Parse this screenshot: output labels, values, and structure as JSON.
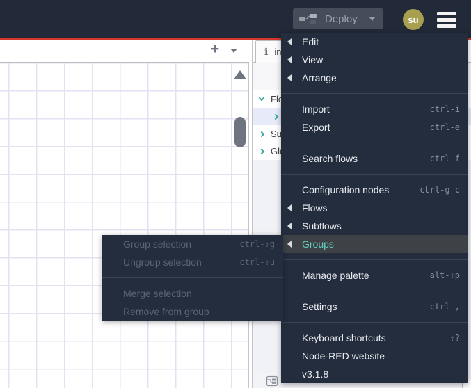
{
  "header": {
    "deploy_button": {
      "label": "Deploy",
      "icon": "deploy-node-icon",
      "state": "disabled"
    },
    "user_avatar": {
      "initials": "su"
    },
    "menu_button": {
      "icon": "hamburger"
    }
  },
  "workspace": {
    "tabbar": {
      "add_glyph": "+",
      "tab_list_icon": "chevron-down"
    },
    "canvas": {
      "grid_size_px": 40,
      "scroll_up_icon": "triangle-up"
    }
  },
  "sidebar": {
    "active_tab": {
      "label": "info",
      "icon_glyph": "i"
    },
    "tree": {
      "rows": [
        {
          "label": "Flows",
          "state": "expanded",
          "level": 0,
          "selected": false
        },
        {
          "label": "",
          "state": "collapsed",
          "level": 1,
          "selected": true
        },
        {
          "label": "Subflows",
          "state": "collapsed",
          "level": 0,
          "selected": false
        },
        {
          "label": "Global Configuration Nodes",
          "state": "collapsed",
          "level": 0,
          "selected": false
        }
      ]
    }
  },
  "menu": {
    "items": [
      {
        "label": "Edit",
        "shortcut": "",
        "has_submenu": true
      },
      {
        "label": "View",
        "shortcut": "",
        "has_submenu": true
      },
      {
        "label": "Arrange",
        "shortcut": "",
        "has_submenu": true
      },
      {
        "label": "Import",
        "shortcut": "ctrl-i",
        "has_submenu": false
      },
      {
        "label": "Export",
        "shortcut": "ctrl-e",
        "has_submenu": false
      },
      {
        "label": "Search flows",
        "shortcut": "ctrl-f",
        "has_submenu": false
      },
      {
        "label": "Configuration nodes",
        "shortcut": "ctrl-g c",
        "has_submenu": false
      },
      {
        "label": "Flows",
        "shortcut": "",
        "has_submenu": true
      },
      {
        "label": "Subflows",
        "shortcut": "",
        "has_submenu": true
      },
      {
        "label": "Groups",
        "shortcut": "",
        "has_submenu": true,
        "active": true
      },
      {
        "label": "Manage palette",
        "shortcut": "alt-⇧p",
        "has_submenu": false
      },
      {
        "label": "Settings",
        "shortcut": "ctrl-,",
        "has_submenu": false
      },
      {
        "label": "Keyboard shortcuts",
        "shortcut": "⇧?",
        "has_submenu": false
      },
      {
        "label": "Node-RED website",
        "shortcut": "",
        "has_submenu": false
      },
      {
        "label": "v3.1.8",
        "shortcut": "",
        "has_submenu": false
      }
    ]
  },
  "groups_submenu": {
    "items": [
      {
        "label": "Group selection",
        "shortcut": "ctrl-⇧g",
        "disabled": true
      },
      {
        "label": "Ungroup selection",
        "shortcut": "ctrl-⇧u",
        "disabled": true
      },
      {
        "label": "Merge selection",
        "shortcut": "",
        "disabled": true
      },
      {
        "label": "Remove from group",
        "shortcut": "",
        "disabled": true
      }
    ]
  },
  "colors": {
    "header_bg": "#222938",
    "accent_red": "#d6352b",
    "menu_bg": "#232d3d",
    "active_item_bg": "#3e4247",
    "active_item_text": "#64cdbd",
    "disabled_text": "#5a6473",
    "shortcut_text": "#848ea0",
    "avatar_bg": "#a89f50",
    "grid_line": "#e4e1f3",
    "selected_row_bg": "#e7eaf8",
    "tree_chevron": "#35a79d"
  }
}
